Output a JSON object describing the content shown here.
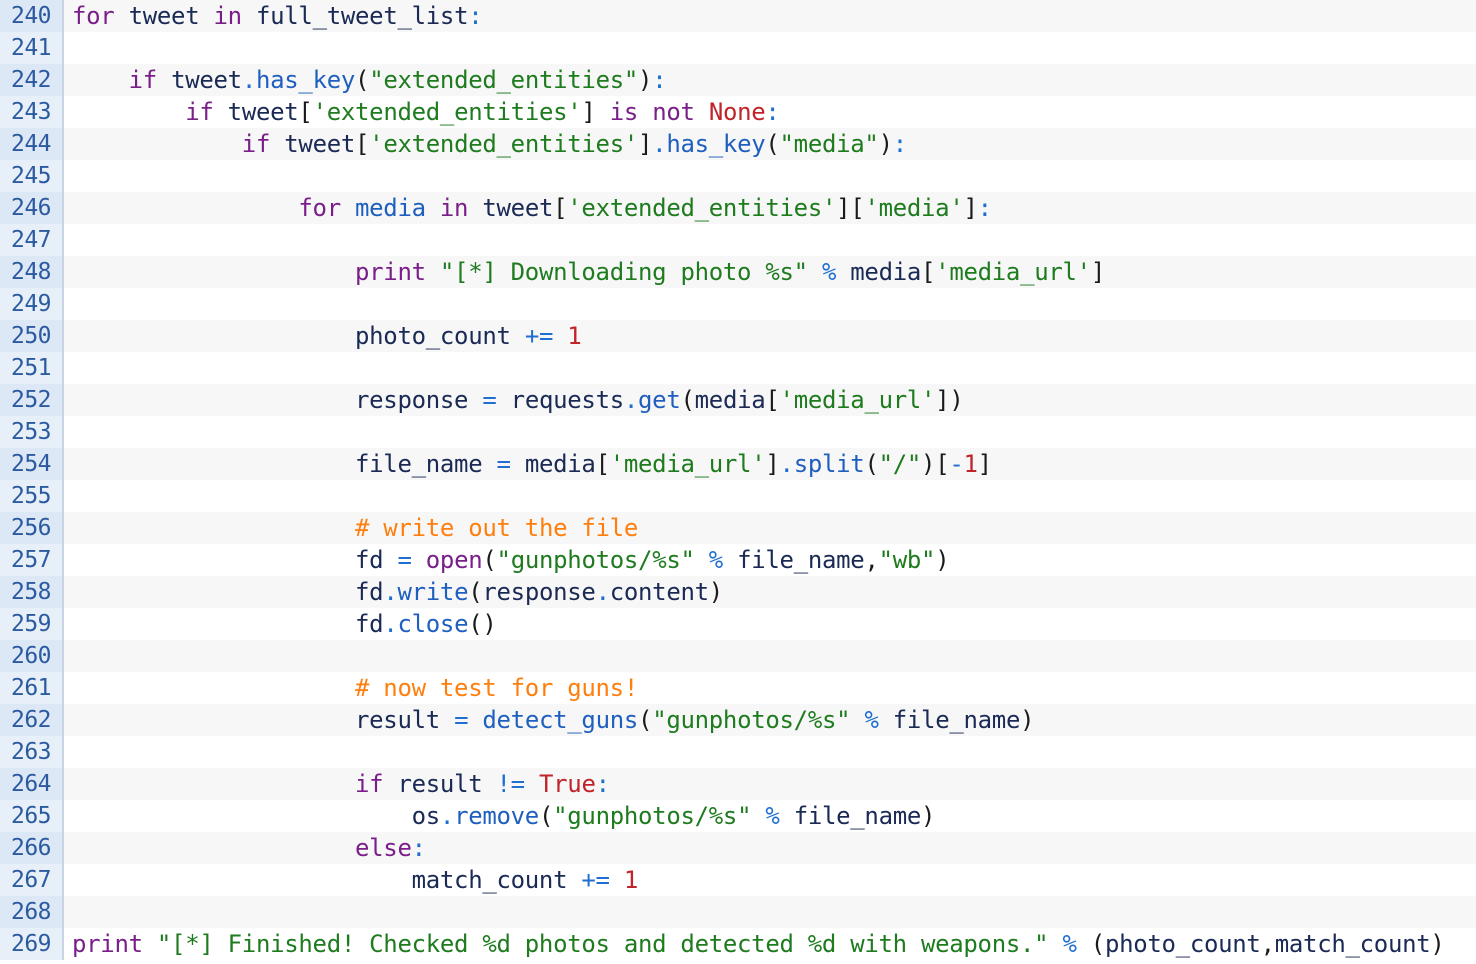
{
  "editor": {
    "lines": [
      {
        "number": "240",
        "indent": "",
        "tokens": [
          {
            "t": "kw",
            "v": "for"
          },
          {
            "t": "p",
            "v": " "
          },
          {
            "t": "id",
            "v": "tweet"
          },
          {
            "t": "p",
            "v": " "
          },
          {
            "t": "kw",
            "v": "in"
          },
          {
            "t": "p",
            "v": " "
          },
          {
            "t": "id",
            "v": "full_tweet_list"
          },
          {
            "t": "op",
            "v": ":"
          }
        ]
      },
      {
        "number": "241",
        "indent": "",
        "tokens": []
      },
      {
        "number": "242",
        "indent": "    ",
        "tokens": [
          {
            "t": "kw",
            "v": "if"
          },
          {
            "t": "p",
            "v": " "
          },
          {
            "t": "id",
            "v": "tweet"
          },
          {
            "t": "op",
            "v": "."
          },
          {
            "t": "fn",
            "v": "has_key"
          },
          {
            "t": "p",
            "v": "("
          },
          {
            "t": "str",
            "v": "\"extended_entities\""
          },
          {
            "t": "p",
            "v": ")"
          },
          {
            "t": "op",
            "v": ":"
          }
        ]
      },
      {
        "number": "243",
        "indent": "        ",
        "tokens": [
          {
            "t": "kw",
            "v": "if"
          },
          {
            "t": "p",
            "v": " "
          },
          {
            "t": "id",
            "v": "tweet"
          },
          {
            "t": "p",
            "v": "["
          },
          {
            "t": "str",
            "v": "'extended_entities'"
          },
          {
            "t": "p",
            "v": "]"
          },
          {
            "t": "p",
            "v": " "
          },
          {
            "t": "kw",
            "v": "is"
          },
          {
            "t": "p",
            "v": " "
          },
          {
            "t": "kw",
            "v": "not"
          },
          {
            "t": "p",
            "v": " "
          },
          {
            "t": "num",
            "v": "None"
          },
          {
            "t": "op",
            "v": ":"
          }
        ]
      },
      {
        "number": "244",
        "indent": "            ",
        "tokens": [
          {
            "t": "kw",
            "v": "if"
          },
          {
            "t": "p",
            "v": " "
          },
          {
            "t": "id",
            "v": "tweet"
          },
          {
            "t": "p",
            "v": "["
          },
          {
            "t": "str",
            "v": "'extended_entities'"
          },
          {
            "t": "p",
            "v": "]"
          },
          {
            "t": "op",
            "v": "."
          },
          {
            "t": "fn",
            "v": "has_key"
          },
          {
            "t": "p",
            "v": "("
          },
          {
            "t": "str",
            "v": "\"media\""
          },
          {
            "t": "p",
            "v": ")"
          },
          {
            "t": "op",
            "v": ":"
          }
        ]
      },
      {
        "number": "245",
        "indent": "",
        "tokens": []
      },
      {
        "number": "246",
        "indent": "                ",
        "tokens": [
          {
            "t": "kw",
            "v": "for"
          },
          {
            "t": "p",
            "v": " "
          },
          {
            "t": "fn",
            "v": "media"
          },
          {
            "t": "p",
            "v": " "
          },
          {
            "t": "kw",
            "v": "in"
          },
          {
            "t": "p",
            "v": " "
          },
          {
            "t": "id",
            "v": "tweet"
          },
          {
            "t": "p",
            "v": "["
          },
          {
            "t": "str",
            "v": "'extended_entities'"
          },
          {
            "t": "p",
            "v": "]["
          },
          {
            "t": "str",
            "v": "'media'"
          },
          {
            "t": "p",
            "v": "]"
          },
          {
            "t": "op",
            "v": ":"
          }
        ]
      },
      {
        "number": "247",
        "indent": "",
        "tokens": []
      },
      {
        "number": "248",
        "indent": "                    ",
        "tokens": [
          {
            "t": "kw",
            "v": "print"
          },
          {
            "t": "p",
            "v": " "
          },
          {
            "t": "str",
            "v": "\"[*] Downloading photo %s\""
          },
          {
            "t": "p",
            "v": " "
          },
          {
            "t": "op",
            "v": "%"
          },
          {
            "t": "p",
            "v": " "
          },
          {
            "t": "id",
            "v": "media"
          },
          {
            "t": "p",
            "v": "["
          },
          {
            "t": "str",
            "v": "'media_url'"
          },
          {
            "t": "p",
            "v": "]"
          }
        ]
      },
      {
        "number": "249",
        "indent": "",
        "tokens": []
      },
      {
        "number": "250",
        "indent": "                    ",
        "tokens": [
          {
            "t": "id",
            "v": "photo_count"
          },
          {
            "t": "p",
            "v": " "
          },
          {
            "t": "op",
            "v": "+="
          },
          {
            "t": "p",
            "v": " "
          },
          {
            "t": "num",
            "v": "1"
          }
        ]
      },
      {
        "number": "251",
        "indent": "",
        "tokens": []
      },
      {
        "number": "252",
        "indent": "                    ",
        "tokens": [
          {
            "t": "id",
            "v": "response"
          },
          {
            "t": "p",
            "v": " "
          },
          {
            "t": "op",
            "v": "="
          },
          {
            "t": "p",
            "v": " "
          },
          {
            "t": "id",
            "v": "requests"
          },
          {
            "t": "op",
            "v": "."
          },
          {
            "t": "fn",
            "v": "get"
          },
          {
            "t": "p",
            "v": "("
          },
          {
            "t": "id",
            "v": "media"
          },
          {
            "t": "p",
            "v": "["
          },
          {
            "t": "str",
            "v": "'media_url'"
          },
          {
            "t": "p",
            "v": "])"
          }
        ]
      },
      {
        "number": "253",
        "indent": "",
        "tokens": []
      },
      {
        "number": "254",
        "indent": "                    ",
        "tokens": [
          {
            "t": "id",
            "v": "file_name"
          },
          {
            "t": "p",
            "v": " "
          },
          {
            "t": "op",
            "v": "="
          },
          {
            "t": "p",
            "v": " "
          },
          {
            "t": "id",
            "v": "media"
          },
          {
            "t": "p",
            "v": "["
          },
          {
            "t": "str",
            "v": "'media_url'"
          },
          {
            "t": "p",
            "v": "]"
          },
          {
            "t": "op",
            "v": "."
          },
          {
            "t": "fn",
            "v": "split"
          },
          {
            "t": "p",
            "v": "("
          },
          {
            "t": "str",
            "v": "\"/\""
          },
          {
            "t": "p",
            "v": ")["
          },
          {
            "t": "op",
            "v": "-"
          },
          {
            "t": "num",
            "v": "1"
          },
          {
            "t": "p",
            "v": "]"
          }
        ]
      },
      {
        "number": "255",
        "indent": "",
        "tokens": []
      },
      {
        "number": "256",
        "indent": "                    ",
        "tokens": [
          {
            "t": "cm",
            "v": "# write out the file"
          }
        ]
      },
      {
        "number": "257",
        "indent": "                    ",
        "tokens": [
          {
            "t": "id",
            "v": "fd"
          },
          {
            "t": "p",
            "v": " "
          },
          {
            "t": "op",
            "v": "="
          },
          {
            "t": "p",
            "v": " "
          },
          {
            "t": "bi",
            "v": "open"
          },
          {
            "t": "p",
            "v": "("
          },
          {
            "t": "str",
            "v": "\"gunphotos/%s\""
          },
          {
            "t": "p",
            "v": " "
          },
          {
            "t": "op",
            "v": "%"
          },
          {
            "t": "p",
            "v": " "
          },
          {
            "t": "id",
            "v": "file_name"
          },
          {
            "t": "p",
            "v": ","
          },
          {
            "t": "str",
            "v": "\"wb\""
          },
          {
            "t": "p",
            "v": ")"
          }
        ]
      },
      {
        "number": "258",
        "indent": "                    ",
        "tokens": [
          {
            "t": "id",
            "v": "fd"
          },
          {
            "t": "op",
            "v": "."
          },
          {
            "t": "fn",
            "v": "write"
          },
          {
            "t": "p",
            "v": "("
          },
          {
            "t": "id",
            "v": "response"
          },
          {
            "t": "op",
            "v": "."
          },
          {
            "t": "id",
            "v": "content"
          },
          {
            "t": "p",
            "v": ")"
          }
        ]
      },
      {
        "number": "259",
        "indent": "                    ",
        "tokens": [
          {
            "t": "id",
            "v": "fd"
          },
          {
            "t": "op",
            "v": "."
          },
          {
            "t": "fn",
            "v": "close"
          },
          {
            "t": "p",
            "v": "()"
          }
        ]
      },
      {
        "number": "260",
        "indent": "",
        "tokens": []
      },
      {
        "number": "261",
        "indent": "                    ",
        "tokens": [
          {
            "t": "cm",
            "v": "# now test for guns!"
          }
        ]
      },
      {
        "number": "262",
        "indent": "                    ",
        "tokens": [
          {
            "t": "id",
            "v": "result"
          },
          {
            "t": "p",
            "v": " "
          },
          {
            "t": "op",
            "v": "="
          },
          {
            "t": "p",
            "v": " "
          },
          {
            "t": "fn",
            "v": "detect_guns"
          },
          {
            "t": "p",
            "v": "("
          },
          {
            "t": "str",
            "v": "\"gunphotos/%s\""
          },
          {
            "t": "p",
            "v": " "
          },
          {
            "t": "op",
            "v": "%"
          },
          {
            "t": "p",
            "v": " "
          },
          {
            "t": "id",
            "v": "file_name"
          },
          {
            "t": "p",
            "v": ")"
          }
        ]
      },
      {
        "number": "263",
        "indent": "",
        "tokens": []
      },
      {
        "number": "264",
        "indent": "                    ",
        "tokens": [
          {
            "t": "kw",
            "v": "if"
          },
          {
            "t": "p",
            "v": " "
          },
          {
            "t": "id",
            "v": "result"
          },
          {
            "t": "p",
            "v": " "
          },
          {
            "t": "op",
            "v": "!="
          },
          {
            "t": "p",
            "v": " "
          },
          {
            "t": "num",
            "v": "True"
          },
          {
            "t": "op",
            "v": ":"
          }
        ]
      },
      {
        "number": "265",
        "indent": "                        ",
        "tokens": [
          {
            "t": "id",
            "v": "os"
          },
          {
            "t": "op",
            "v": "."
          },
          {
            "t": "fn",
            "v": "remove"
          },
          {
            "t": "p",
            "v": "("
          },
          {
            "t": "str",
            "v": "\"gunphotos/%s\""
          },
          {
            "t": "p",
            "v": " "
          },
          {
            "t": "op",
            "v": "%"
          },
          {
            "t": "p",
            "v": " "
          },
          {
            "t": "id",
            "v": "file_name"
          },
          {
            "t": "p",
            "v": ")"
          }
        ]
      },
      {
        "number": "266",
        "indent": "                    ",
        "tokens": [
          {
            "t": "kw",
            "v": "else"
          },
          {
            "t": "op",
            "v": ":"
          }
        ]
      },
      {
        "number": "267",
        "indent": "                        ",
        "tokens": [
          {
            "t": "id",
            "v": "match_count"
          },
          {
            "t": "p",
            "v": " "
          },
          {
            "t": "op",
            "v": "+="
          },
          {
            "t": "p",
            "v": " "
          },
          {
            "t": "num",
            "v": "1"
          }
        ]
      },
      {
        "number": "268",
        "indent": "",
        "tokens": []
      },
      {
        "number": "269",
        "indent": "",
        "tokens": [
          {
            "t": "kw",
            "v": "print"
          },
          {
            "t": "p",
            "v": " "
          },
          {
            "t": "str",
            "v": "\"[*] Finished! Checked %d photos and detected %d with weapons.\""
          },
          {
            "t": "p",
            "v": " "
          },
          {
            "t": "op",
            "v": "%"
          },
          {
            "t": "p",
            "v": " "
          },
          {
            "t": "p",
            "v": "("
          },
          {
            "t": "id",
            "v": "photo_count"
          },
          {
            "t": "p",
            "v": ","
          },
          {
            "t": "id",
            "v": "match_count"
          },
          {
            "t": "p",
            "v": ")"
          }
        ]
      }
    ]
  },
  "colors": {
    "keyword": "#7a1f8a",
    "identifier": "#1a2a55",
    "function": "#1f5fbf",
    "operator": "#1f6fd1",
    "string": "#1e7b1e",
    "number": "#c0242a",
    "comment": "#ff7f0e",
    "gutter_text": "#2c5aa0",
    "gutter_bg": "#e7eff9"
  }
}
